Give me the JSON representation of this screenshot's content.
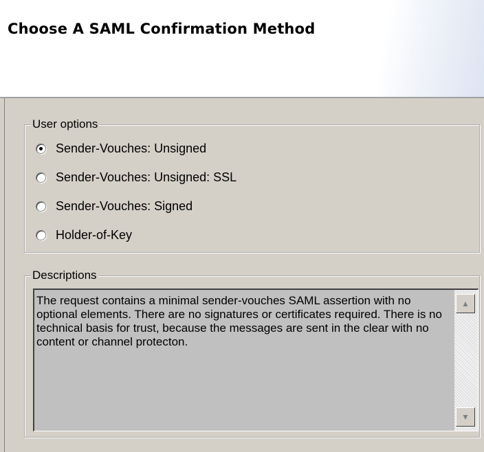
{
  "header": {
    "title": "Choose A SAML Confirmation Method"
  },
  "user_options": {
    "legend": "User options",
    "items": [
      {
        "label": "Sender-Vouches: Unsigned",
        "selected": true
      },
      {
        "label": "Sender-Vouches: Unsigned: SSL",
        "selected": false
      },
      {
        "label": "Sender-Vouches: Signed",
        "selected": false
      },
      {
        "label": "Holder-of-Key",
        "selected": false
      }
    ]
  },
  "descriptions": {
    "legend": "Descriptions",
    "text": "The request contains a minimal sender-vouches SAML assertion with no optional elements. There are no signatures or certificates required. There is no technical basis for trust, because the messages are sent in the clear with no content or channel protecton."
  },
  "icons": {
    "scroll_up": "scroll-up-arrow-icon",
    "scroll_down": "scroll-down-arrow-icon"
  }
}
